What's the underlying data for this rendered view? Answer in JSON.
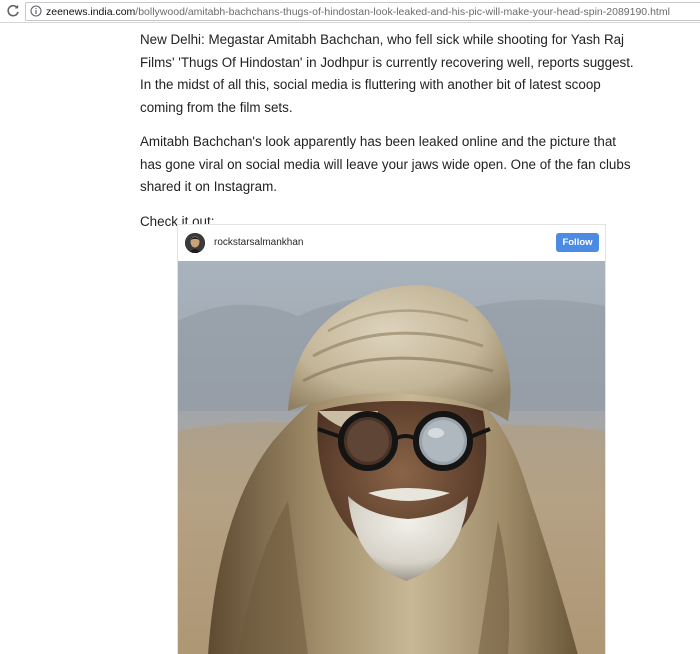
{
  "browser": {
    "url_domain": "zeenews.india.com",
    "url_path": "/bollywood/amitabh-bachchans-thugs-of-hindostan-look-leaked-and-his-pic-will-make-your-head-spin-2089190.html"
  },
  "article": {
    "paragraphs": [
      "New Delhi: Megastar Amitabh Bachchan, who fell sick while shooting for Yash Raj Films' 'Thugs Of Hindostan' in Jodhpur is currently recovering well, reports suggest. In the midst of all this, social media is fluttering with another bit of latest scoop coming from the film sets.",
      "Amitabh Bachchan's look apparently has been leaked online and the picture that has gone viral on social media will leave your jaws wide open. One of the fan clubs shared it on Instagram.",
      "Check it out:"
    ]
  },
  "instagram_embed": {
    "username": "rockstarsalmankhan",
    "follow_label": "Follow",
    "follow_color": "#4c8be3"
  },
  "icons": {
    "reload": "reload-icon",
    "info": "info-icon"
  }
}
